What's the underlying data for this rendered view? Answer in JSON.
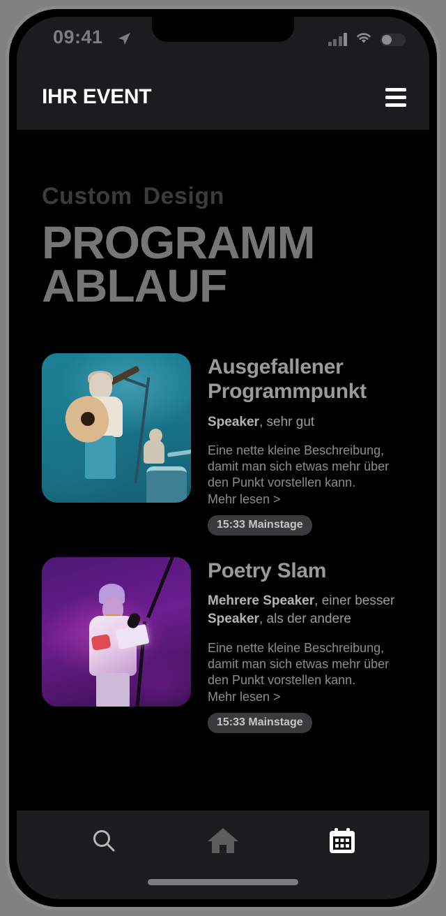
{
  "status_bar": {
    "time": "09:41",
    "location_icon": "location-arrow-icon",
    "cellular_icon": "cellular-signal-icon",
    "wifi_icon": "wifi-icon",
    "battery_icon": "battery-icon"
  },
  "header": {
    "title": "IHR EVENT",
    "menu_icon": "hamburger-menu-icon"
  },
  "hero": {
    "eyebrow": "Custom Design",
    "title_line1": "PROGRAMM",
    "title_line2": "ABLAUF"
  },
  "program": {
    "items": [
      {
        "thumb_alt": "concert-guitarist-photo",
        "title": "Ausgefallener Programmpunkt",
        "speaker_bold": "Speaker",
        "speaker_rest": ", sehr gut",
        "speaker_bold2": "",
        "speaker_rest2": "",
        "description": "Eine nette kleine Beschreibung, damit man sich etwas mehr über den Punkt vorstellen kann.",
        "more_label": "Mehr lesen >",
        "badge": "15:33 Mainstage"
      },
      {
        "thumb_alt": "poetry-slam-performer-photo",
        "title": "Poetry Slam",
        "speaker_bold": "Mehrere Speaker",
        "speaker_rest": ", einer besser",
        "speaker_bold2": "Speaker",
        "speaker_rest2": ", als der andere",
        "description": "Eine nette kleine Beschreibung, damit man sich etwas mehr über den Punkt vorstellen kann.",
        "more_label": "Mehr lesen >",
        "badge": "15:33 Mainstage"
      }
    ]
  },
  "bottom_nav": {
    "items": [
      {
        "icon": "search-icon",
        "active": false
      },
      {
        "icon": "home-icon",
        "active": false
      },
      {
        "icon": "calendar-icon",
        "active": true
      }
    ]
  },
  "colors": {
    "screen_bg": "#000000",
    "bar_bg": "#1c1c1e",
    "title_text": "#ffffff",
    "hero_eyebrow": "#3b3b3b",
    "hero_title": "#767676",
    "badge_bg": "#3a3a3c",
    "frame": "#8a8a8a"
  }
}
